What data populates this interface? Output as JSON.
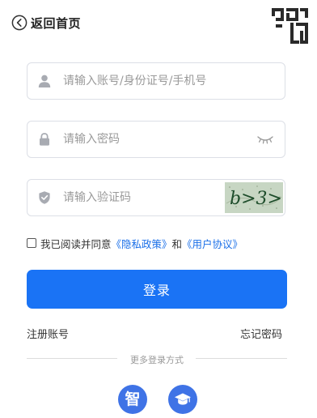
{
  "header": {
    "back_label": "返回首页",
    "back_icon": "circle-chevron-left-icon",
    "qr_icon": "qr-code-icon"
  },
  "form": {
    "account": {
      "placeholder": "请输入账号/身份证号/手机号",
      "value": "",
      "icon": "user-icon"
    },
    "password": {
      "placeholder": "请输入密码",
      "value": "",
      "icon": "lock-icon",
      "toggle_icon": "eye-closed-icon"
    },
    "captcha": {
      "placeholder": "请输入验证码",
      "value": "",
      "icon": "shield-check-icon",
      "image_text": "b>3>"
    },
    "agreement": {
      "checked": false,
      "prefix": "我已阅读并同意",
      "privacy_link": "《隐私政策》",
      "conjunction": "和",
      "terms_link": "《用户协议》"
    },
    "submit_label": "登录"
  },
  "links": {
    "register": "注册账号",
    "forgot": "忘记密码"
  },
  "other_login": {
    "label": "更多登录方式",
    "options": [
      {
        "glyph": "智",
        "icon": "zhi-login-icon"
      },
      {
        "icon": "graduation-cap-icon"
      }
    ]
  },
  "colors": {
    "primary": "#1a73f5",
    "link": "#1a6fe8",
    "social": "#3f73e6",
    "border": "#dcdfe6",
    "placeholder": "#9a9a9a"
  }
}
